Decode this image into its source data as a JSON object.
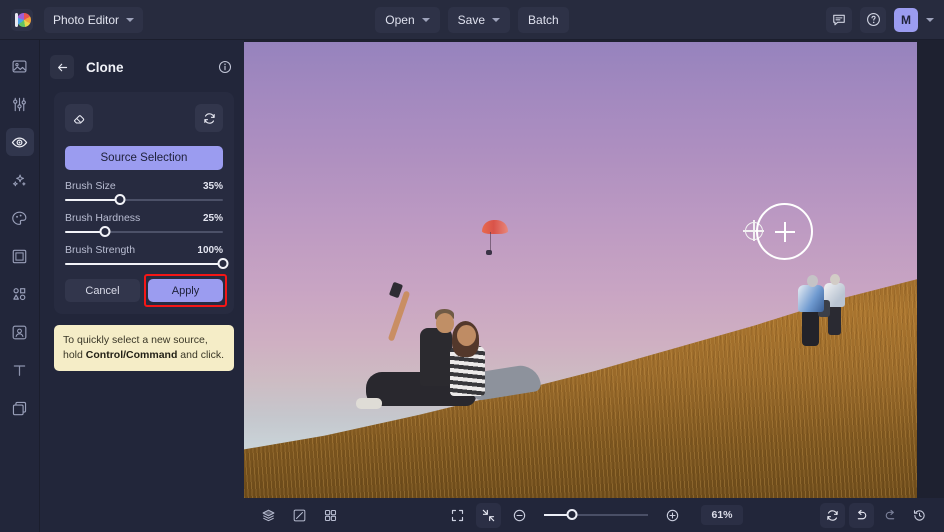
{
  "topbar": {
    "logo_icon": "color-wheel-logo-icon",
    "app_menu_label": "Photo Editor",
    "app_menu_chevron": "chevron-down-icon",
    "open_label": "Open",
    "save_label": "Save",
    "batch_label": "Batch",
    "feedback_icon": "chat-bubble-icon",
    "help_icon": "question-mark-circle-icon",
    "avatar_initial": "M",
    "avatar_chevron": "chevron-down-icon",
    "accent_color": "#9b9cf0"
  },
  "rail": {
    "items": [
      {
        "name": "sidebar-item-image",
        "icon": "image-icon",
        "active": false
      },
      {
        "name": "sidebar-item-adjust",
        "icon": "sliders-icon",
        "active": false
      },
      {
        "name": "sidebar-item-retouch",
        "icon": "eye-icon",
        "active": true
      },
      {
        "name": "sidebar-item-effects",
        "icon": "sparkles-icon",
        "active": false
      },
      {
        "name": "sidebar-item-color",
        "icon": "palette-icon",
        "active": false
      },
      {
        "name": "sidebar-item-frame",
        "icon": "frame-icon",
        "active": false
      },
      {
        "name": "sidebar-item-shapes",
        "icon": "shapes-icon",
        "active": false
      },
      {
        "name": "sidebar-item-portrait",
        "icon": "portrait-ai-icon",
        "active": false
      },
      {
        "name": "sidebar-item-text",
        "icon": "text-t-icon",
        "active": false
      },
      {
        "name": "sidebar-item-layers",
        "icon": "layers-copy-icon",
        "active": false
      }
    ]
  },
  "panel": {
    "back_icon": "arrow-left-icon",
    "title": "Clone",
    "info_icon": "info-circle-icon",
    "eraser_icon": "eraser-icon",
    "reset_icon": "reset-refresh-icon",
    "source_selection_label": "Source Selection",
    "sliders": [
      {
        "label": "Brush Size",
        "value": "35%",
        "percent": 35
      },
      {
        "label": "Brush Hardness",
        "value": "25%",
        "percent": 25
      },
      {
        "label": "Brush Strength",
        "value": "100%",
        "percent": 100
      }
    ],
    "cancel_label": "Cancel",
    "apply_label": "Apply",
    "apply_highlight_color": "#f41616",
    "tooltip": {
      "text_before": "To quickly select a new source, hold ",
      "text_bold": "Control/Command",
      "text_after": " and click.",
      "background_color": "#f5edc7"
    }
  },
  "canvas": {
    "photo_description": "Couple sitting on a golden grassy hillside taking a selfie at sunset with a purple-pink sky, a paraglider above, and two people standing on the ridge at right",
    "brush_cursor_icon": "brush-circle-plus-cursor",
    "clone_source_icon": "clone-source-crosshair-icon"
  },
  "bottombar": {
    "layers_icon": "layers-stack-icon",
    "compare_icon": "compare-split-icon",
    "grid_icon": "grid-view-icon",
    "fit_screen_icon": "fit-to-screen-icon",
    "actual_size_icon": "shrink-arrows-icon",
    "zoom_out_icon": "zoom-out-minus-icon",
    "zoom_in_icon": "zoom-in-plus-icon",
    "zoom_value": "61%",
    "reset_view_icon": "reset-view-icon",
    "undo_icon": "undo-arrow-icon",
    "redo_icon": "redo-arrow-icon",
    "history_icon": "history-clock-icon"
  }
}
